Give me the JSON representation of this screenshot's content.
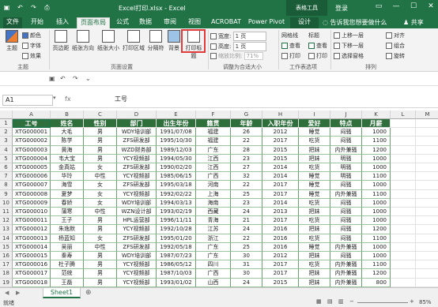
{
  "window": {
    "title": "Excel打印.xlsx - Excel",
    "context_label": "表格工具",
    "login": "登录",
    "search_hint": "告诉我您想要做什么",
    "share": "共享"
  },
  "tabs": [
    "文件",
    "开始",
    "插入",
    "页面布局",
    "公式",
    "数据",
    "审阅",
    "视图",
    "ACROBAT",
    "Power Pivot",
    "设计"
  ],
  "active_tab": "页面布局",
  "ribbon": {
    "themes": {
      "main": "主题",
      "colors": "颜色",
      "fonts": "字体",
      "effects": "效果",
      "group": "主题"
    },
    "page_setup": {
      "margins": "页边距",
      "orientation": "纸张方向",
      "size": "纸张大小",
      "print_area": "打印区域",
      "breaks": "分隔符",
      "background": "背景",
      "print_titles": "打印标题",
      "group": "页面设置"
    },
    "scale": {
      "width_label": "宽度:",
      "width_val": "1 页",
      "height_label": "高度:",
      "height_val": "1 页",
      "scale_label": "缩放比例:",
      "scale_val": "71%",
      "group": "调整为合适大小"
    },
    "sheet_options": {
      "gridlines": "网格线",
      "headings": "标题",
      "view1": "查看",
      "view2": "查看",
      "print1": "打印",
      "print2": "打印",
      "group": "工作表选项"
    },
    "arrange": {
      "forward": "上移一层",
      "backward": "下移一层",
      "pane": "选择窗格",
      "align": "对齐",
      "group_btn": "组合",
      "rotate": "旋转",
      "group": "排列"
    }
  },
  "formula_bar": {
    "name_box": "A1",
    "fx": "fx",
    "value": "工号"
  },
  "columns": [
    "A",
    "B",
    "C",
    "D",
    "E",
    "F",
    "G",
    "H",
    "I",
    "J",
    "K",
    "L",
    "M"
  ],
  "table_headers": [
    "工号",
    "姓名",
    "性别",
    "部门",
    "出生年份",
    "籍贯",
    "年龄",
    "入职年份",
    "爱好",
    "特点",
    "月薪"
  ],
  "rows": [
    [
      "XTG000001",
      "大毛",
      "男",
      "WDY培训部",
      "1991/07/08",
      "福建",
      "26",
      "2012",
      "睡觉",
      "闷骚",
      "1000"
    ],
    [
      "XTG000002",
      "陈学",
      "男",
      "ZFS研发部",
      "1995/10/30",
      "福建",
      "22",
      "2017",
      "吃货",
      "闷骚",
      "1100"
    ],
    [
      "XTG000003",
      "黄海",
      "男",
      "WZD财务部",
      "1989/12/03",
      "广东",
      "28",
      "2015",
      "把妹",
      "内外兼骚",
      "1200"
    ],
    [
      "XTG000004",
      "韦大宝",
      "男",
      "YCY视频部",
      "1994/05/30",
      "江西",
      "23",
      "2015",
      "把妹",
      "明骚",
      "1000"
    ],
    [
      "XTG000005",
      "金真姑",
      "女",
      "ZFS研发部",
      "1990/02/20",
      "江西",
      "27",
      "2014",
      "吃货",
      "明骚",
      "1000"
    ],
    [
      "XTG000006",
      "华玲",
      "中性",
      "YCY视频部",
      "1985/06/15",
      "广西",
      "32",
      "2014",
      "睡觉",
      "明骚",
      "1100"
    ],
    [
      "XTG000007",
      "海雪",
      "女",
      "ZFS研发部",
      "1995/03/18",
      "河南",
      "22",
      "2017",
      "睡觉",
      "闷骚",
      "1000"
    ],
    [
      "XTG000008",
      "夏梦",
      "女",
      "YCY视频部",
      "1992/02/22",
      "上海",
      "25",
      "2017",
      "睡觉",
      "内外兼骚",
      "1100"
    ],
    [
      "XTG000009",
      "春娇",
      "女",
      "WDY培训部",
      "1994/03/13",
      "海南",
      "23",
      "2014",
      "吃货",
      "闷骚",
      "1000"
    ],
    [
      "XTG000010",
      "蒲寒",
      "中性",
      "WZN设计部",
      "1993/02/19",
      "西藏",
      "24",
      "2013",
      "把妹",
      "闷骚",
      "1000"
    ],
    [
      "XTG000011",
      "王子",
      "男",
      "HPL运营部",
      "1996/11/11",
      "青海",
      "21",
      "2017",
      "吃货",
      "闷骚",
      "1000"
    ],
    [
      "XTG000012",
      "朱逸默",
      "男",
      "YCY视频部",
      "1992/10/28",
      "江苏",
      "24",
      "2016",
      "把妹",
      "闷骚",
      "1200"
    ],
    [
      "XTG000013",
      "杨蓝知",
      "女",
      "ZFS研发部",
      "1995/01/20",
      "浙江",
      "22",
      "2016",
      "吃货",
      "闷骚",
      "1100"
    ],
    [
      "XTG000014",
      "吴丽",
      "中性",
      "ZFS研发部",
      "1992/05/18",
      "广东",
      "25",
      "2016",
      "睡觉",
      "内外兼骚",
      "1000"
    ],
    [
      "XTG000015",
      "秦寿",
      "男",
      "WDY培训部",
      "1987/07/23",
      "广东",
      "30",
      "2012",
      "把妹",
      "闷骚",
      "1000"
    ],
    [
      "XTG000016",
      "杜子腾",
      "男",
      "YCY视频部",
      "1986/05/12",
      "四川",
      "31",
      "2017",
      "吃货",
      "内外兼骚",
      "1100"
    ],
    [
      "XTG000017",
      "范统",
      "男",
      "YCY视频部",
      "1987/10/03",
      "广西",
      "30",
      "2017",
      "把妹",
      "内外兼骚",
      "1200"
    ],
    [
      "XTG000018",
      "王磊",
      "男",
      "YCY视频部",
      "1993/01/02",
      "山西",
      "24",
      "2015",
      "把妹",
      "内外兼骚",
      "800"
    ]
  ],
  "row_numbers": [
    "1",
    "2",
    "3",
    "4",
    "5",
    "6",
    "7",
    "8",
    "9",
    "10",
    "11",
    "12",
    "13",
    "14",
    "15",
    "16",
    "17",
    "18",
    "19"
  ],
  "sheet_tab": "Sheet1",
  "status": {
    "ready": "就绪",
    "zoom": "85%"
  },
  "colors": {
    "excel_green": "#217346",
    "header_fill": "#2e6f3b",
    "highlight_box": "#e03a3a"
  }
}
